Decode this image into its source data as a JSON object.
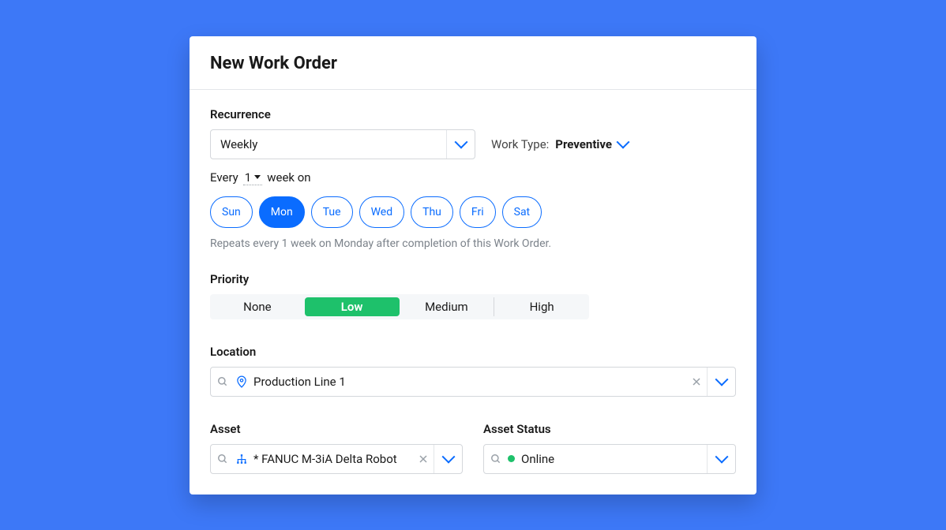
{
  "header": {
    "title": "New Work Order"
  },
  "recurrence": {
    "label": "Recurrence",
    "value": "Weekly",
    "every_prefix": "Every",
    "every_value": "1",
    "every_suffix": "week on",
    "days": [
      "Sun",
      "Mon",
      "Tue",
      "Wed",
      "Thu",
      "Fri",
      "Sat"
    ],
    "selected_day_index": 1,
    "hint": "Repeats every 1 week on Monday after completion of this Work Order."
  },
  "work_type": {
    "label": "Work Type:",
    "value": "Preventive"
  },
  "priority": {
    "label": "Priority",
    "options": [
      "None",
      "Low",
      "Medium",
      "High"
    ],
    "selected_index": 1
  },
  "location": {
    "label": "Location",
    "value": "Production Line 1"
  },
  "asset": {
    "label": "Asset",
    "value": "* FANUC M-3iA Delta Robot"
  },
  "asset_status": {
    "label": "Asset Status",
    "value": "Online"
  }
}
